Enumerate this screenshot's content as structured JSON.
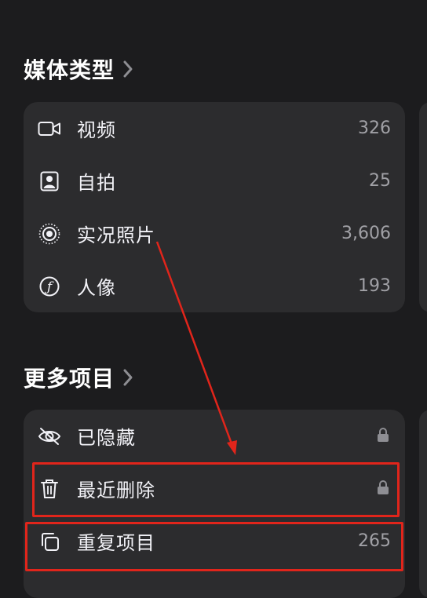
{
  "media_types": {
    "title": "媒体类型",
    "items": [
      {
        "label": "视频",
        "count": "326",
        "icon": "video-icon"
      },
      {
        "label": "自拍",
        "count": "25",
        "icon": "selfie-portrait-icon"
      },
      {
        "label": "实况照片",
        "count": "3,606",
        "icon": "live-photo-icon"
      },
      {
        "label": "人像",
        "count": "193",
        "icon": "portrait-aperture-icon"
      }
    ]
  },
  "more_items": {
    "title": "更多项目",
    "items": [
      {
        "label": "已隐藏",
        "icon": "eye-slash-icon",
        "locked": true
      },
      {
        "label": "最近删除",
        "icon": "trash-icon",
        "locked": true
      },
      {
        "label": "重复项目",
        "count": "265",
        "icon": "duplicate-icon"
      }
    ]
  },
  "annotation": {
    "color": "#e1251b"
  }
}
